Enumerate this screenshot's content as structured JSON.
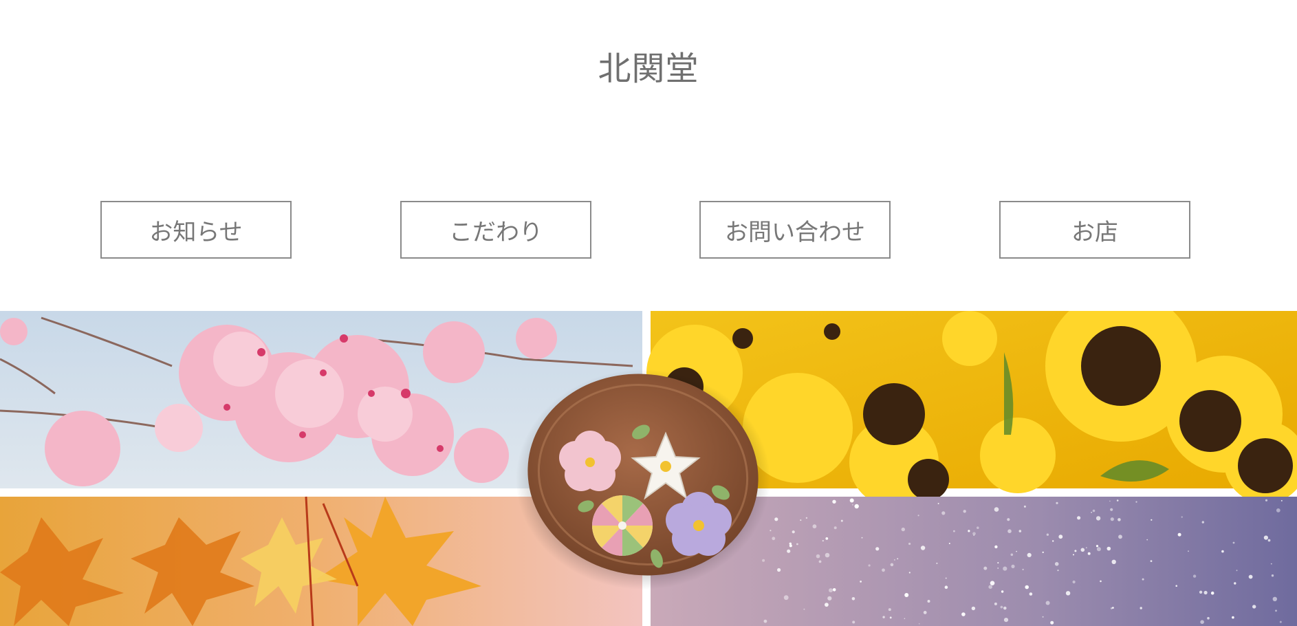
{
  "header": {
    "title": "北関堂"
  },
  "nav": {
    "items": [
      {
        "label": "お知らせ"
      },
      {
        "label": "こだわり"
      },
      {
        "label": "お問い合わせ"
      },
      {
        "label": "お店"
      }
    ]
  },
  "gallery": {
    "panels": [
      {
        "icon": "cherry-blossom-photo"
      },
      {
        "icon": "sunflower-photo"
      },
      {
        "icon": "autumn-maple-photo"
      },
      {
        "icon": "sparkle-bokeh-photo"
      },
      {
        "icon": "wagashi-plate-photo"
      }
    ]
  }
}
